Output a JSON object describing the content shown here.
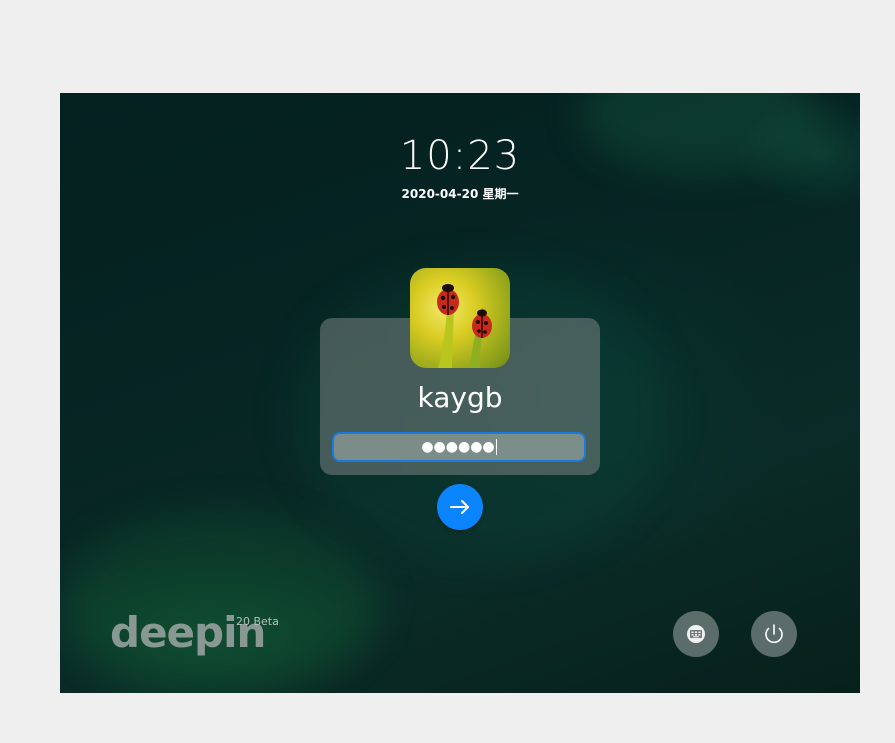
{
  "lockscreen": {
    "time": "10:23",
    "date": "2020-04-20 星期一",
    "username": "kaygb",
    "password_mask": "●●●●●●",
    "avatar_icon": "ladybug-photo-avatar",
    "submit_icon": "arrow-right-icon"
  },
  "branding": {
    "logo_text": "deepin",
    "version": "20 Beta"
  },
  "controls": {
    "keyboard_icon": "keyboard-layout-icon",
    "power_icon": "power-icon"
  },
  "colors": {
    "accent": "#0a84ff",
    "background": "#062523",
    "page_bg": "#efefef"
  }
}
